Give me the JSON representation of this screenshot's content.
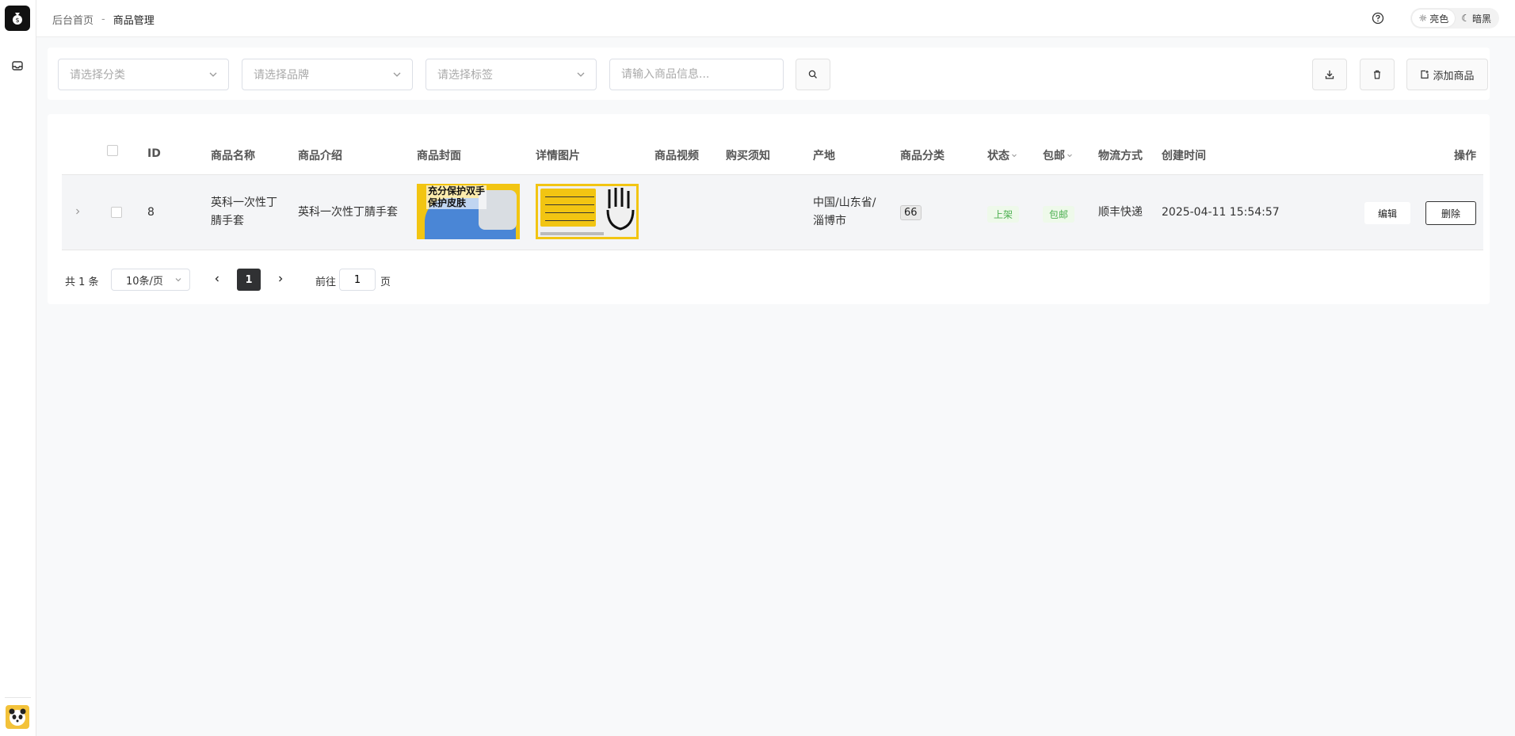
{
  "header": {
    "breadcrumb_home": "后台首页",
    "breadcrumb_sep": "-",
    "breadcrumb_current": "商品管理",
    "theme_light": "亮色",
    "theme_dark": "暗黑"
  },
  "filters": {
    "category_placeholder": "请选择分类",
    "brand_placeholder": "请选择品牌",
    "tag_placeholder": "请选择标签",
    "search_placeholder": "请输入商品信息...",
    "add_label": "添加商品"
  },
  "table": {
    "headers": {
      "id": "ID",
      "name": "商品名称",
      "intro": "商品介绍",
      "cover": "商品封面",
      "detail": "详情图片",
      "video": "商品视频",
      "notice": "购买须知",
      "origin": "产地",
      "category": "商品分类",
      "status": "状态",
      "shipping": "包邮",
      "logistics": "物流方式",
      "created": "创建时间",
      "actions": "操作"
    },
    "rows": [
      {
        "id": "8",
        "name_line1": "英科一次性丁",
        "name_line2": "腈手套",
        "intro": "英科一次性丁腈手套",
        "cover_text_line1": "充分保护双手",
        "cover_text_line2": "保护皮肤",
        "origin_line1": "中国/山东省/",
        "origin_line2": "淄博市",
        "category": "66",
        "status": "上架",
        "shipping": "包邮",
        "logistics": "顺丰快递",
        "created": "2025-04-11 15:54:57",
        "edit_label": "编辑",
        "delete_label": "删除"
      }
    ]
  },
  "pagination": {
    "total": "共 1 条",
    "page_size": "10条/页",
    "current_page": "1",
    "goto_label": "前往",
    "goto_value": "1",
    "page_suffix": "页"
  },
  "colors": {
    "status_green": "#4caf50",
    "active_page": "#303133",
    "cover_yellow": "#f2c512"
  }
}
